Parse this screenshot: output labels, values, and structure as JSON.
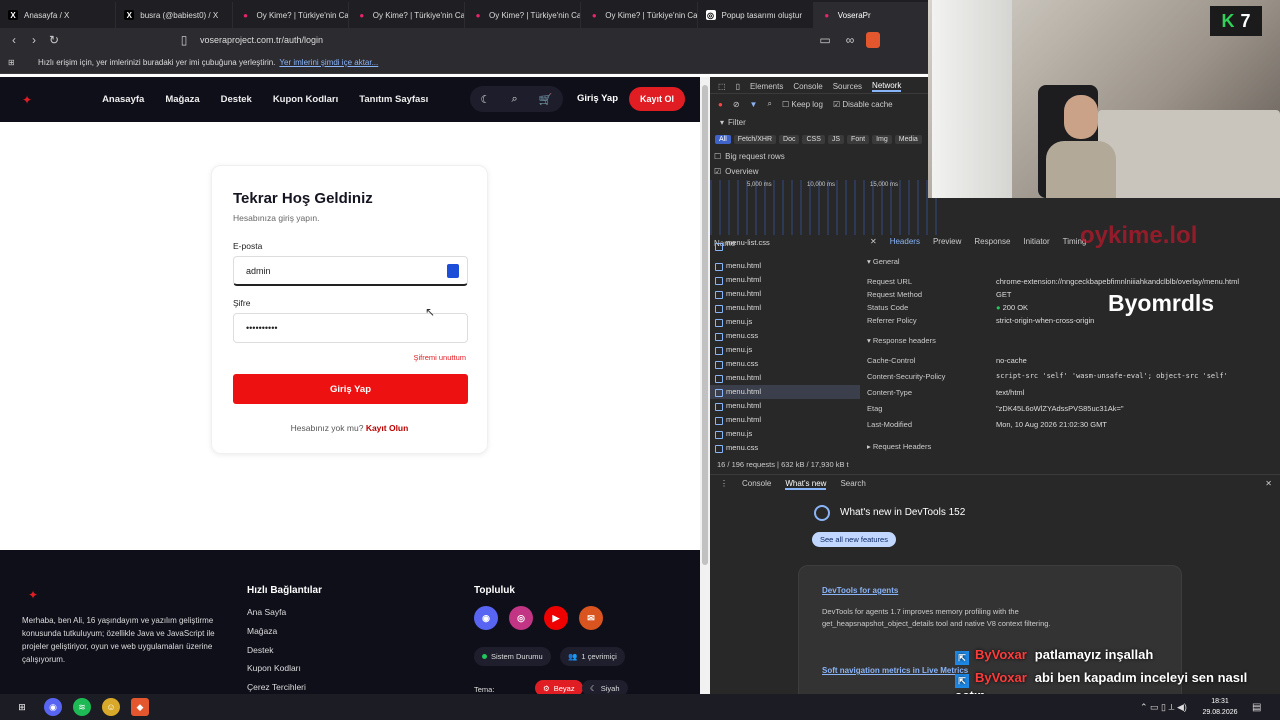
{
  "browser": {
    "tabs": [
      {
        "label": "Anasayfa / X",
        "icon": "x-icon"
      },
      {
        "label": "busra (@babiest0) / X",
        "icon": "x-icon"
      },
      {
        "label": "Oy Kime? | Türkiye'nin Ca",
        "icon": "pin-icon"
      },
      {
        "label": "Oy Kime? | Türkiye'nin Ca",
        "icon": "pin-icon"
      },
      {
        "label": "Oy Kime? | Türkiye'nin Ca",
        "icon": "pin-icon"
      },
      {
        "label": "Oy Kime? | Türkiye'nin Ca",
        "icon": "pin-icon"
      },
      {
        "label": "Popup tasarımı oluştur",
        "icon": "openai-icon"
      },
      {
        "label": "VoseraPr",
        "icon": "pin-icon"
      }
    ],
    "url": "voseraproject.com.tr/auth/login",
    "bookmarks_text": "Hızlı erişim için, yer imlerinizi buradaki yer imi çubuğuna yerleştirin.",
    "bookmarks_link": "Yer imlerini şimdi içe aktar..."
  },
  "site": {
    "nav": [
      "Anasayfa",
      "Mağaza",
      "Destek",
      "Kupon Kodları",
      "Tanıtım Sayfası"
    ],
    "login_label": "Giriş Yap",
    "register_label": "Kayıt Ol"
  },
  "login": {
    "title": "Tekrar Hoş Geldiniz",
    "subtitle": "Hesabınıza giriş yapın.",
    "email_label": "E-posta",
    "email_value": "admin",
    "password_label": "Şifre",
    "password_value": "••••••••••",
    "forgot": "Şifremi unuttum",
    "submit": "Giriş Yap",
    "no_account": "Hesabınız yok mu?",
    "signup": "Kayıt Olun"
  },
  "footer": {
    "about": "Merhaba, ben Ali, 16 yaşındayım ve yazılım geliştirme konusunda tutkuluyum; özellikle Java ve JavaScript ile projeler geliştiriyor, oyun ve web uygulamaları üzerine çalışıyorum.",
    "quick_title": "Hızlı Bağlantılar",
    "quick_links": [
      "Ana Sayfa",
      "Mağaza",
      "Destek",
      "Kupon Kodları",
      "Çerez Tercihleri"
    ],
    "community_title": "Topluluk",
    "status": "Sistem Durumu",
    "online": "1 çevrimiçi",
    "theme_label": "Tema:",
    "theme_white": "Beyaz",
    "theme_black": "Siyah"
  },
  "devtools": {
    "tabs": [
      "Elements",
      "Console",
      "Sources",
      "Network"
    ],
    "keep_log": "Keep log",
    "disable_cache": "Disable cache",
    "filter": "Filter",
    "types": [
      "All",
      "Fetch/XHR",
      "Doc",
      "CSS",
      "JS",
      "Font",
      "Img",
      "Media"
    ],
    "big_rows": "Big request rows",
    "overview": "Overview",
    "ticks": [
      "5,000 ms",
      "10,000 ms",
      "15,000 ms"
    ],
    "name_header": "Name",
    "files": [
      "menu-list.css",
      "menu.html",
      "menu.html",
      "menu.html",
      "menu.html",
      "menu.js",
      "menu.css",
      "menu.js",
      "menu.css",
      "menu.html",
      "menu.html",
      "menu.html",
      "menu.html",
      "menu.js",
      "menu.css"
    ],
    "summary": "16 / 196 requests",
    "transfer": "632 kB / 17,930 kB t",
    "detail_tabs": [
      "Headers",
      "Preview",
      "Response",
      "Initiator",
      "Timing"
    ],
    "general": "General",
    "general_rows": [
      {
        "k": "Request URL",
        "v": "chrome-extension://nngceckbapebfimnlniiiahkandclblb/overlay/menu.html"
      },
      {
        "k": "Request Method",
        "v": "GET"
      },
      {
        "k": "Status Code",
        "v": "200 OK"
      },
      {
        "k": "Referrer Policy",
        "v": "strict-origin-when-cross-origin"
      }
    ],
    "response_headers": "Response headers",
    "response_rows": [
      {
        "k": "Cache-Control",
        "v": "no-cache"
      },
      {
        "k": "Content-Security-Policy",
        "v": "script-src 'self' 'wasm-unsafe-eval'; object-src 'self'"
      },
      {
        "k": "Content-Type",
        "v": "text/html"
      },
      {
        "k": "Etag",
        "v": "\"zDK45L6oWlZYAdssPVS85uc31Ak=\""
      },
      {
        "k": "Last-Modified",
        "v": "Mon, 10 Aug 2026 21:02:30 GMT"
      }
    ],
    "request_headers": "Request Headers",
    "drawer_tabs": [
      "Console",
      "What's new",
      "Search"
    ],
    "whats_new_title": "What's new in DevTools 152",
    "see_all": "See all new features",
    "agents_title": "DevTools for agents",
    "agents_text": "DevTools for agents 1.7 improves memory profiling with the get_heapsnapshot_object_details tool and native V8 context filtering.",
    "soft_nav": "Soft navigation metrics in Live Metrics"
  },
  "overlay": {
    "badge": "7",
    "watermark": "oykime.lol",
    "streamer": "Byomrdls",
    "chat": [
      {
        "user": "ByVoxar",
        "msg": "patlamayız inşallah"
      },
      {
        "user": "ByVoxar",
        "msg": "abi ben kapadım inceleyi sen nasıl açtın"
      }
    ]
  },
  "taskbar": {
    "time": "18:31",
    "date": "29.08.2026"
  },
  "colors": {
    "brand_red": "#e11d24",
    "nav_dark": "#0f0f1a",
    "devtools_bg": "#282828",
    "selected_tab_blue": "#3f63c8"
  }
}
